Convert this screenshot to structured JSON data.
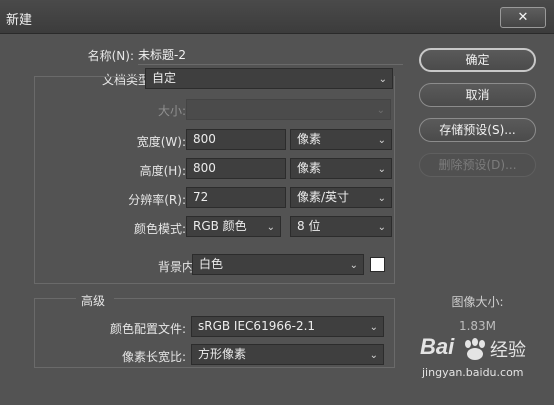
{
  "window": {
    "title": "新建",
    "close_glyph": "✕"
  },
  "form": {
    "name": {
      "label": "名称(N):",
      "value": "未标题-2"
    },
    "doc_type": {
      "label": "文档类型:",
      "value": "自定"
    },
    "size": {
      "label": "大小:",
      "value": ""
    },
    "width": {
      "label": "宽度(W):",
      "value": "800",
      "unit": "像素"
    },
    "height": {
      "label": "高度(H):",
      "value": "800",
      "unit": "像素"
    },
    "resolution": {
      "label": "分辨率(R):",
      "value": "72",
      "unit": "像素/英寸"
    },
    "color_mode": {
      "label": "颜色模式:",
      "value": "RGB 颜色",
      "depth": "8 位"
    },
    "background": {
      "label": "背景内容:",
      "value": "白色",
      "swatch_color": "#ffffff"
    }
  },
  "advanced": {
    "label": "高级",
    "color_profile": {
      "label": "颜色配置文件:",
      "value": "sRGB IEC61966-2.1"
    },
    "pixel_aspect": {
      "label": "像素长宽比:",
      "value": "方形像素"
    }
  },
  "buttons": {
    "ok": "确定",
    "cancel": "取消",
    "save_preset": "存储预设(S)...",
    "delete_preset": "删除预设(D)..."
  },
  "image_size": {
    "label": "图像大小:",
    "value": "1.83M"
  },
  "watermark": {
    "brand": "Bai",
    "brand2": "经验",
    "url": "jingyan.baidu.com"
  }
}
